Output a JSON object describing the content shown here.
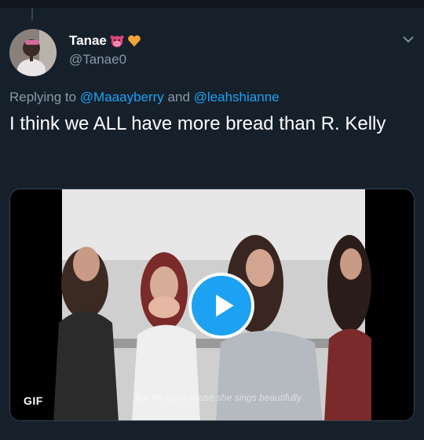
{
  "tweet": {
    "display_name": "Tanae",
    "emojis": [
      "cow-face-icon",
      "orange-heart-icon"
    ],
    "handle": "@Tanae0",
    "replying_prefix": "Replying to",
    "reply_mentions": [
      "@Maaayberry",
      "@leahshianne"
    ],
    "reply_joiner": "and",
    "text": "I think we ALL have more bread than R. Kelly"
  },
  "media": {
    "type": "gif",
    "badge": "GIF",
    "subtitle": "but it's good cause she sings beautifully"
  },
  "colors": {
    "background": "#15202b",
    "accent": "#1da1f2",
    "secondary_text": "#8899a6",
    "border": "#38444d"
  }
}
